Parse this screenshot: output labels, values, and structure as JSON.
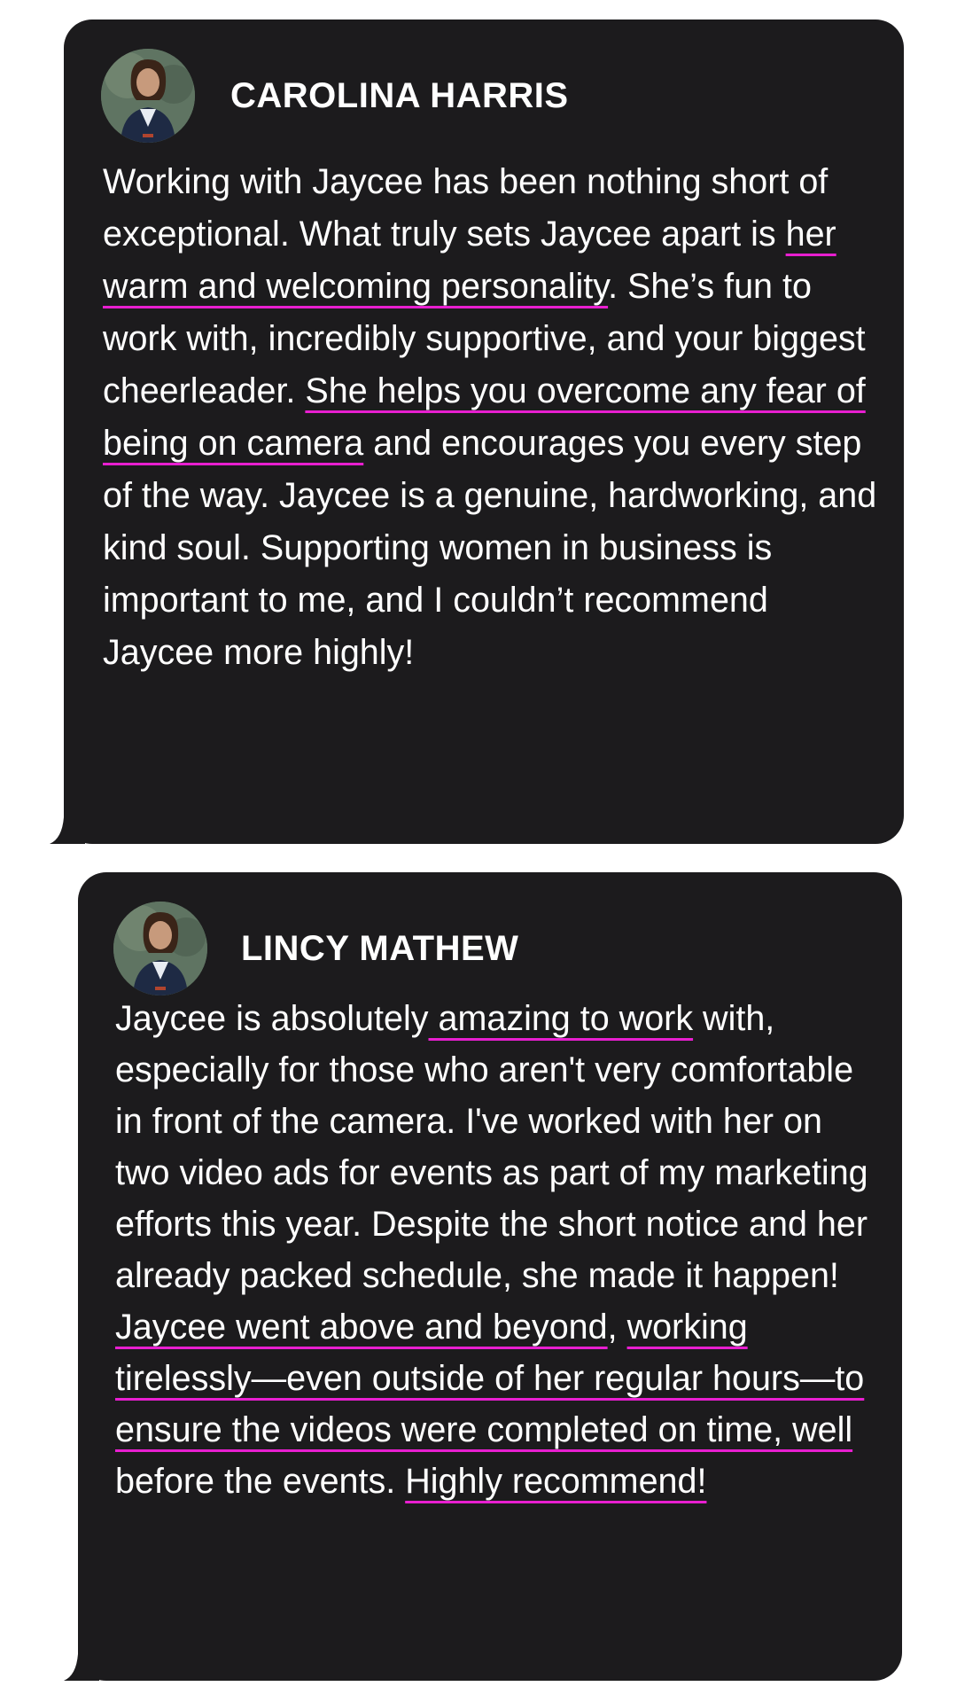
{
  "testimonials": [
    {
      "name": "CAROLINA HARRIS",
      "segments": [
        "Working with Jaycee has been nothing short of exceptional. What truly sets Jaycee apart is ",
        "her warm and welcoming personality",
        ". She’s fun to work with, incredibly supportive, and your biggest cheerleader. ",
        "She helps you overcome any fear of being on camera",
        " and encourages you every step of the way. Jaycee is a genuine, hardworking, and kind soul. Supporting women in business is important to me, and I couldn’t recommend Jaycee more highly!"
      ]
    },
    {
      "name": "LINCY MATHEW",
      "segments": [
        "Jaycee is absolutely",
        " amazing to work",
        " with, especially for those who aren't very comfortable in front of the camera. I've worked with her on two video ads for events as part of my marketing efforts this year. Despite the short notice and her already packed schedule, she made it happen!",
        " Jaycee went above and beyond",
        ", ",
        "working tirelessly—even outside of her regular hours—to ensure the videos were completed on time, well",
        " before the events. ",
        "Highly recommend!"
      ]
    }
  ],
  "colors": {
    "card_background": "#1c1b1d",
    "text": "#ffffff",
    "highlight_underline": "#e81fd0"
  },
  "icons": {
    "avatar": "person-portrait-avatar",
    "bubble_tail": "speech-bubble-tail"
  }
}
